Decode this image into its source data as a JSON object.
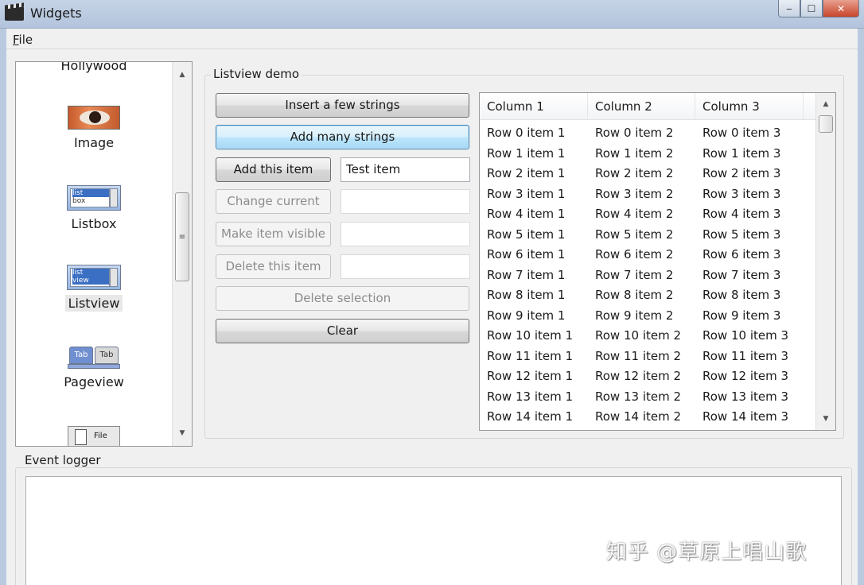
{
  "window": {
    "title": "Widgets",
    "icon": "clapperboard-icon",
    "controls": {
      "minimize": "‒",
      "maximize": "☐",
      "close": "✕"
    }
  },
  "menubar": {
    "file_prefix": "F",
    "file_rest": "ile"
  },
  "widget_list": {
    "items": [
      {
        "label": "Hollywood",
        "icon": "hollywood-icon"
      },
      {
        "label": "Image",
        "icon": "eye-image-icon"
      },
      {
        "label": "Listbox",
        "icon": "listbox-icon",
        "icon_text": [
          "list",
          "box"
        ]
      },
      {
        "label": "Listview",
        "icon": "listview-icon",
        "icon_text": [
          "list",
          "view"
        ],
        "current": true
      },
      {
        "label": "Pageview",
        "icon": "tabs-icon",
        "icon_text": [
          "Tab",
          "Tab"
        ]
      },
      {
        "label": "File",
        "icon": "file-icon"
      }
    ]
  },
  "listview_demo": {
    "title": "Listview demo",
    "buttons": {
      "insert_few": "Insert a few strings",
      "add_many": "Add many strings",
      "add_item": "Add this item",
      "change_current": "Change current",
      "make_visible": "Make item visible",
      "delete_item": "Delete this item",
      "delete_selection": "Delete selection",
      "clear": "Clear"
    },
    "fields": {
      "add_item_value": "Test item",
      "change_current_value": "",
      "make_visible_value": "",
      "delete_item_value": ""
    },
    "columns": [
      "Column 1",
      "Column 2",
      "Column 3"
    ],
    "rows": [
      [
        "Row 0 item 1",
        "Row 0 item 2",
        "Row 0 item 3"
      ],
      [
        "Row 1 item 1",
        "Row 1 item 2",
        "Row 1 item 3"
      ],
      [
        "Row 2 item 1",
        "Row 2 item 2",
        "Row 2 item 3"
      ],
      [
        "Row 3 item 1",
        "Row 3 item 2",
        "Row 3 item 3"
      ],
      [
        "Row 4 item 1",
        "Row 4 item 2",
        "Row 4 item 3"
      ],
      [
        "Row 5 item 1",
        "Row 5 item 2",
        "Row 5 item 3"
      ],
      [
        "Row 6 item 1",
        "Row 6 item 2",
        "Row 6 item 3"
      ],
      [
        "Row 7 item 1",
        "Row 7 item 2",
        "Row 7 item 3"
      ],
      [
        "Row 8 item 1",
        "Row 8 item 2",
        "Row 8 item 3"
      ],
      [
        "Row 9 item 1",
        "Row 9 item 2",
        "Row 9 item 3"
      ],
      [
        "Row 10 item 1",
        "Row 10 item 2",
        "Row 10 item 3"
      ],
      [
        "Row 11 item 1",
        "Row 11 item 2",
        "Row 11 item 3"
      ],
      [
        "Row 12 item 1",
        "Row 12 item 2",
        "Row 12 item 3"
      ],
      [
        "Row 13 item 1",
        "Row 13 item 2",
        "Row 13 item 3"
      ],
      [
        "Row 14 item 1",
        "Row 14 item 2",
        "Row 14 item 3"
      ]
    ]
  },
  "event_logger": {
    "title": "Event logger",
    "content": ""
  },
  "watermark": "知乎 @草原上唱山歌"
}
